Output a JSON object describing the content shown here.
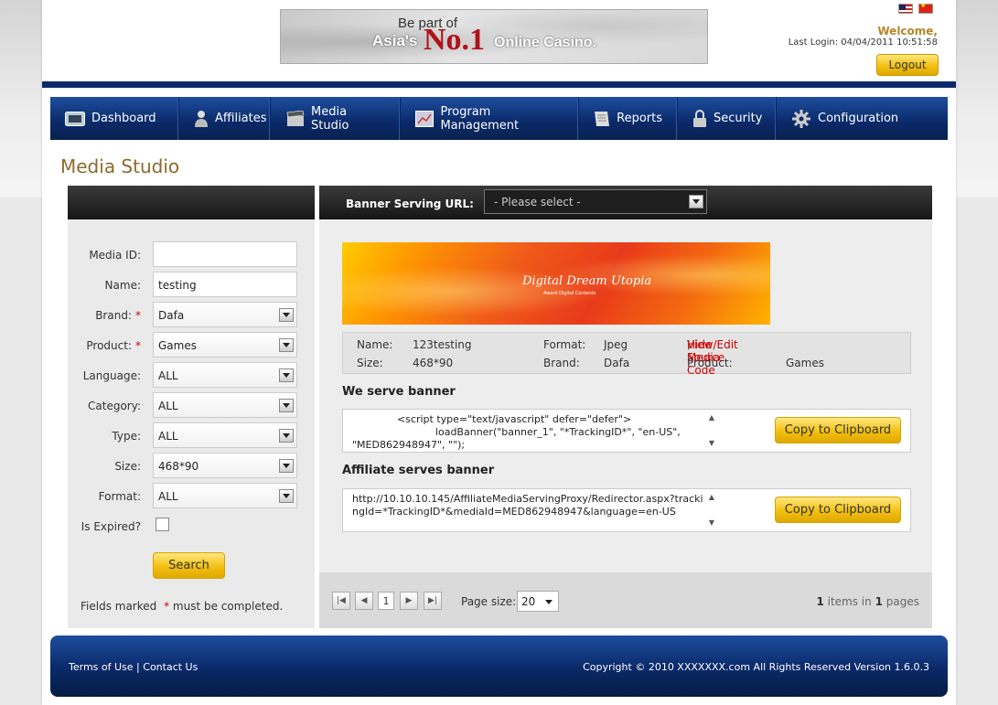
{
  "header": {
    "ad": {
      "line1": "Be part of",
      "line2": "Asia's",
      "no1": "No.1",
      "line3": "Online Casino."
    },
    "welcome": "Welcome,",
    "last_login": "Last Login: 04/04/2011 10:51:58",
    "logout_label": "Logout"
  },
  "nav": {
    "items": [
      {
        "label": "Dashboard",
        "icon": "dashboard-icon"
      },
      {
        "label": "Affiliates",
        "icon": "user-icon"
      },
      {
        "label": "Media Studio",
        "icon": "clapperboard-icon"
      },
      {
        "label": "Program Management",
        "icon": "chart-icon"
      },
      {
        "label": "Reports",
        "icon": "report-icon"
      },
      {
        "label": "Security",
        "icon": "lock-icon"
      },
      {
        "label": "Configuration",
        "icon": "gear-icon"
      }
    ]
  },
  "page_title": "Media Studio",
  "filter": {
    "media_id": {
      "label": "Media ID:",
      "value": ""
    },
    "name": {
      "label": "Name:",
      "value": "testing"
    },
    "brand": {
      "label": "Brand:",
      "value": "Dafa",
      "required": "*"
    },
    "product": {
      "label": "Product:",
      "value": "Games",
      "required": "*"
    },
    "language": {
      "label": "Language:",
      "value": "ALL"
    },
    "category": {
      "label": "Category:",
      "value": "ALL"
    },
    "type": {
      "label": "Type:",
      "value": "ALL"
    },
    "size": {
      "label": "Size:",
      "value": "468*90"
    },
    "format": {
      "label": "Format:",
      "value": "ALL"
    },
    "is_expired": {
      "label": "Is Expired?",
      "checked": false
    },
    "search_label": "Search",
    "note_prefix": "Fields marked",
    "note_star": "*",
    "note_suffix": "must be completed."
  },
  "results": {
    "banner_serving_url_label": "Banner Serving URL:",
    "banner_serving_url_value": "- Please select -",
    "banner": {
      "title": "Digital Dream Utopia",
      "subtitle": "Award Digital Contents"
    },
    "info": {
      "name_label": "Name:",
      "name_value": "123testing",
      "size_label": "Size:",
      "size_value": "468*90",
      "format_label": "Format:",
      "format_value": "Jpeg",
      "brand_label": "Brand:",
      "brand_value": "Dafa",
      "hide_source_link": "Hide Source Code",
      "link_separator": ",",
      "view_edit_link": "View/Edit Media",
      "product_label": "Product:",
      "product_value": "Games"
    },
    "we_serve_title": "We serve banner",
    "we_serve_code": "              <script type=\"text/javascript\" defer=\"defer\">\n                          loadBanner(\"banner_1\", \"*TrackingID*\", \"en-US\", \"MED862948947\", \"\");",
    "affiliate_serves_title": "Affiliate serves banner",
    "affiliate_serves_code": "http://10.10.10.145/AffiliateMediaServingProxy/Redirector.aspx?trackingId=*TrackingID*&mediaId=MED862948947&language=en-US",
    "copy_label": "Copy to Clipboard"
  },
  "pager": {
    "current_page": "1",
    "page_size_label": "Page size:",
    "page_size_value": "20",
    "items_count": "1",
    "items_text": "items in",
    "pages_count": "1",
    "pages_text": "pages"
  },
  "footer": {
    "terms": "Terms of Use",
    "separator": "|",
    "contact": "Contact Us",
    "copyright": "Copyright © 2010 XXXXXXX.com All Rights Reserved  Version 1.6.0.3"
  }
}
